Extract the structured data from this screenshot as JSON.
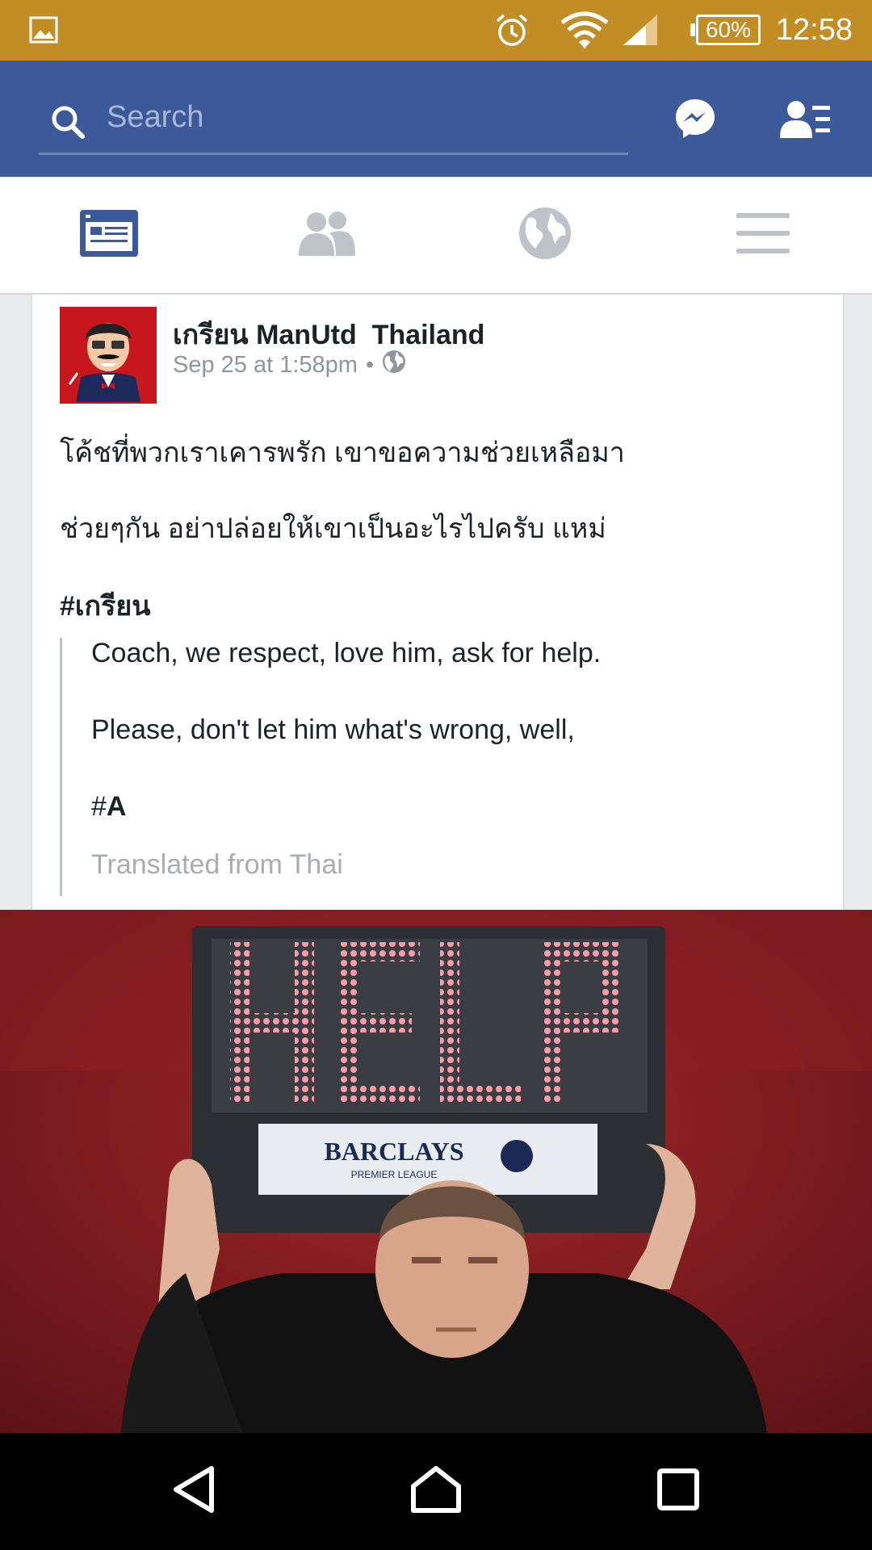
{
  "status_bar": {
    "battery": "60%",
    "time": "12:58",
    "icons": [
      "gallery-icon",
      "alarm-icon",
      "wifi-icon",
      "signal-icon",
      "battery-icon"
    ]
  },
  "header": {
    "search_placeholder": "Search",
    "icons": [
      "search-icon",
      "messenger-icon",
      "friend-requests-icon"
    ],
    "brand_color": "#3c5a99"
  },
  "tabs": [
    {
      "name": "news-feed",
      "icon": "news-feed-icon",
      "active": true
    },
    {
      "name": "friends",
      "icon": "friends-icon",
      "active": false
    },
    {
      "name": "notifications",
      "icon": "globe-icon",
      "active": false
    },
    {
      "name": "menu",
      "icon": "hamburger-menu-icon",
      "active": false
    }
  ],
  "post": {
    "author": "เกรียน ManUtd  Thailand",
    "time": "Sep 25 at 1:58pm",
    "separator": "•",
    "privacy_icon": "globe-icon",
    "lines": [
      "โค้ชที่พวกเราเคารพรัก เขาขอความช่วยเหลือมา",
      "ช่วยๆกัน อย่าปล่อยให้เขาเป็นอะไรไปครับ แหม่"
    ],
    "hashtag": "#เกรียน",
    "translation": {
      "lines": [
        "Coach, we respect, love him, ask for help.",
        "Please, don't let him what's wrong, well,"
      ],
      "hashtag_prefix": "#",
      "hashtag_word": "A",
      "note": "Translated from Thai"
    },
    "image": {
      "board_text": "HELP",
      "sponsor": "BARCLAYS",
      "sponsor_sub": "PREMIER LEAGUE"
    }
  },
  "navbar": {
    "icons": [
      "back-icon",
      "home-icon",
      "recent-apps-icon"
    ]
  }
}
